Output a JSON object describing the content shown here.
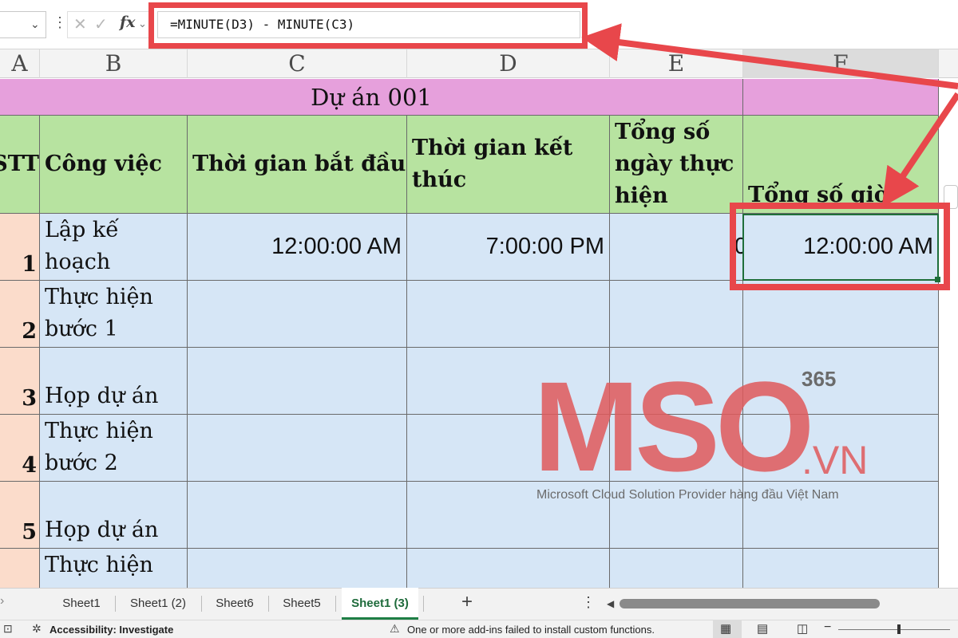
{
  "formula_bar": {
    "formula": "=MINUTE(D3) - MINUTE(C3)",
    "fx_label": "fx"
  },
  "columns": [
    "A",
    "B",
    "C",
    "D",
    "E",
    "F"
  ],
  "title_row": {
    "title": "Dự án 001"
  },
  "headers": {
    "stt": "STT",
    "task": "Công việc",
    "start": "Thời gian bắt đầu",
    "end_line1": "Thời gian kết",
    "end_line2": "thúc",
    "days_line1": "Tổng số",
    "days_line2": "ngày thực",
    "days_line3": "hiện",
    "hours": "Tổng số giờ"
  },
  "rows": [
    {
      "stt": "1",
      "task_line1": "Lập kế",
      "task_line2": "hoạch",
      "start": "12:00:00 AM",
      "end": "7:00:00 PM",
      "days": "0",
      "hours": "12:00:00 AM"
    },
    {
      "stt": "2",
      "task_line1": "Thực hiện",
      "task_line2": "bước 1"
    },
    {
      "stt": "3",
      "task_line1": "",
      "task_line2": "Họp dự án"
    },
    {
      "stt": "4",
      "task_line1": "Thực hiện",
      "task_line2": "bước 2"
    },
    {
      "stt": "5",
      "task_line1": "",
      "task_line2": "Họp dự án"
    },
    {
      "stt": "",
      "task_line1": "Thực hiện",
      "task_line2": ""
    }
  ],
  "sheet_tabs": [
    "Sheet1",
    "Sheet1 (2)",
    "Sheet6",
    "Sheet5",
    "Sheet1 (3)"
  ],
  "active_tab": "Sheet1 (3)",
  "status_bar": {
    "accessibility": "Accessibility: Investigate",
    "addins_message": "One or more add-ins failed to install custom functions."
  },
  "watermark": {
    "brand": "MSO",
    "suffix": ".VN",
    "badge": "365",
    "tagline": "Microsoft Cloud Solution Provider hàng đầu Việt Nam"
  },
  "colors": {
    "title_fill": "#e6a0dc",
    "header_fill": "#b7e3a0",
    "stt_fill": "#fbdccb",
    "body_fill": "#d6e6f6",
    "highlight_red": "#e8474b",
    "watermark_red": "#e05a5c"
  }
}
